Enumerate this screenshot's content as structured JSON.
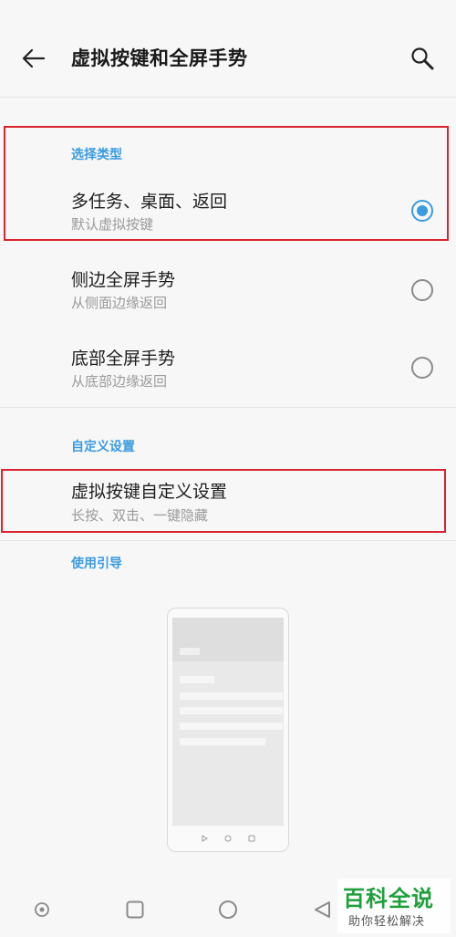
{
  "header": {
    "title": "虚拟按键和全屏手势",
    "back_icon": "arrow-left-icon",
    "search_icon": "search-icon"
  },
  "sections": {
    "select_type": {
      "header": "选择类型",
      "options": [
        {
          "title": "多任务、桌面、返回",
          "subtitle": "默认虚拟按键",
          "selected": true
        },
        {
          "title": "侧边全屏手势",
          "subtitle": "从侧面边缘返回",
          "selected": false
        },
        {
          "title": "底部全屏手势",
          "subtitle": "从底部边缘返回",
          "selected": false
        }
      ]
    },
    "custom": {
      "header": "自定义设置",
      "item": {
        "title": "虚拟按键自定义设置",
        "subtitle": "长按、双击、一键隐藏"
      }
    },
    "guide": {
      "header": "使用引导"
    }
  },
  "system_nav": {
    "buttons": [
      "dot-circle-icon",
      "square-icon",
      "circle-icon",
      "triangle-back-icon"
    ]
  },
  "watermark": {
    "main": "百科全说",
    "sub": "助你轻松解决"
  },
  "colors": {
    "accent": "#3a9be0",
    "highlight_box": "#d9232e",
    "watermark": "#1fa03c"
  }
}
